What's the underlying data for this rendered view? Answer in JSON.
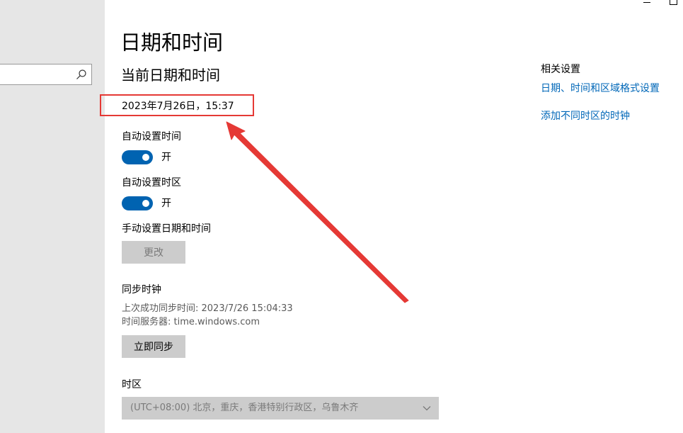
{
  "page": {
    "title": "日期和时间",
    "section_title": "当前日期和时间",
    "current_datetime": "2023年7月26日，15:37"
  },
  "auto_time": {
    "label": "自动设置时间",
    "state_text": "开",
    "on": true
  },
  "auto_timezone": {
    "label": "自动设置时区",
    "state_text": "开",
    "on": true
  },
  "manual": {
    "label": "手动设置日期和时间",
    "button_label": "更改"
  },
  "sync": {
    "title": "同步时钟",
    "last_sync": "上次成功同步时间: 2023/7/26 15:04:33",
    "server": "时间服务器: time.windows.com",
    "button_label": "立即同步"
  },
  "timezone": {
    "label": "时区",
    "selected": "(UTC+08:00) 北京，重庆，香港特别行政区，乌鲁木齐"
  },
  "related": {
    "title": "相关设置",
    "links": [
      "日期、时间和区域格式设置",
      "添加不同时区的时钟"
    ]
  },
  "colors": {
    "accent": "#0063b1",
    "link": "#0067b8",
    "annotation": "#e53935"
  }
}
